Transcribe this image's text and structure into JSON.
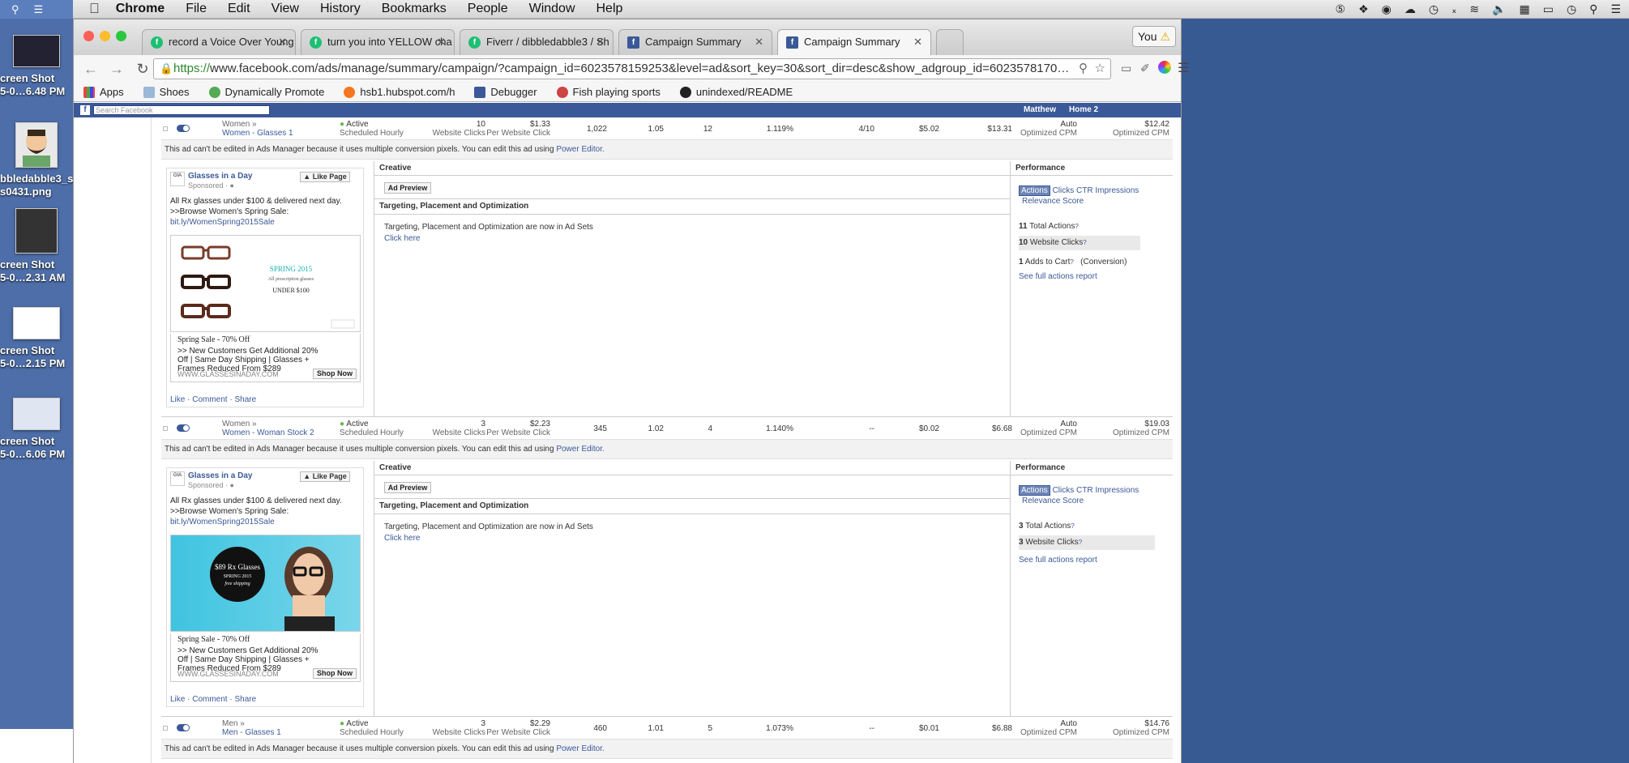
{
  "menubar": {
    "app": "Chrome",
    "items": [
      "File",
      "Edit",
      "View",
      "History",
      "Bookmarks",
      "People",
      "Window",
      "Help"
    ]
  },
  "desktop": {
    "icons": [
      {
        "label1": "creen Shot",
        "label2": "5-0…6.48 PM"
      },
      {
        "label1": "bbledabble3_s",
        "label2": "s0431.png"
      },
      {
        "label1": "creen Shot",
        "label2": "5-0…2.31 AM"
      },
      {
        "label1": "creen Shot",
        "label2": "5-0…2.15 PM"
      },
      {
        "label1": "creen Shot",
        "label2": "5-0…6.06 PM"
      }
    ]
  },
  "browser": {
    "tabs": [
      {
        "title": "record a Voice Over Young",
        "icon": "fiverr-icon",
        "color": "#1dbf73"
      },
      {
        "title": "turn you into YELLOW cha",
        "icon": "fiverr-icon",
        "color": "#1dbf73"
      },
      {
        "title": "Fiverr / dibbledabble3 / Sh",
        "icon": "fiverr-icon",
        "color": "#1dbf73"
      },
      {
        "title": "Campaign Summary",
        "icon": "facebook-icon",
        "color": "#3b5998"
      },
      {
        "title": "Campaign Summary",
        "icon": "facebook-icon",
        "color": "#3b5998"
      }
    ],
    "user_button": "You",
    "url_proto": "https://",
    "url_rest": "www.facebook.com/ads/manage/summary/campaign/?campaign_id=6023578159253&level=ad&sort_key=30&sort_dir=desc&show_adgroup_id=6023578170…",
    "bookmarks": [
      "Apps",
      "Shoes",
      "Dynamically Promote",
      "hsb1.hubspot.com/h",
      "Debugger",
      "Fish playing sports",
      "unindexed/README"
    ]
  },
  "fb": {
    "search_placeholder": "Search Facebook",
    "user": "Matthew",
    "home": "Home 2"
  },
  "ads": [
    {
      "group": "Women »",
      "name": "Women - Glasses 1",
      "status": "Active",
      "schedule": "Scheduled Hourly",
      "results": "10",
      "results_label": "Website Clicks",
      "cost": "$1.33",
      "cost_label": "Per Website Click",
      "reach": "1,022",
      "frequency": "1.05",
      "clicks": "12",
      "ctr": "1.119%",
      "relevance": "4/10",
      "cpc": "$5.02",
      "cpm": "$13.31",
      "bid": "Auto",
      "bid_label": "Optimized CPM",
      "spent": "$12.42",
      "spent_label": "Optimized CPM"
    },
    {
      "group": "Women »",
      "name": "Women - Woman Stock 2",
      "status": "Active",
      "schedule": "Scheduled Hourly",
      "results": "3",
      "results_label": "Website Clicks",
      "cost": "$2.23",
      "cost_label": "Per Website Click",
      "reach": "345",
      "frequency": "1.02",
      "clicks": "4",
      "ctr": "1.140%",
      "relevance": "--",
      "cpc": "$0.02",
      "cpm": "$6.68",
      "bid": "Auto",
      "bid_label": "Optimized CPM",
      "spent": "$19.03",
      "spent_label": "Optimized CPM"
    },
    {
      "group": "Men »",
      "name": "Men - Glasses 1",
      "status": "Active",
      "schedule": "Scheduled Hourly",
      "results": "3",
      "results_label": "Website Clicks",
      "cost": "$2.29",
      "cost_label": "Per Website Click",
      "reach": "460",
      "frequency": "1.01",
      "clicks": "5",
      "ctr": "1.073%",
      "relevance": "--",
      "cpc": "$0.01",
      "cpm": "$6.88",
      "bid": "Auto",
      "bid_label": "Optimized CPM",
      "spent": "$14.76",
      "spent_label": "Optimized CPM"
    }
  ],
  "note": {
    "text": "This ad can't be edited in Ads Manager because it uses multiple conversion pixels. You can edit this ad using ",
    "link": "Power Editor."
  },
  "adcard": {
    "page": "Glasses in a Day",
    "sponsored": "Sponsored · ",
    "like_page": "Like Page",
    "body1": "All Rx glasses under $100 & delivered next day.",
    "body2": ">>Browse Women's Spring Sale:",
    "link": "bit.ly/WomenSpring2015Sale",
    "caption": "Spring Sale - 70% Off",
    "desc": ">> New Customers Get Additional 20% Off | Same Day Shipping | Glasses + Frames Reduced From $289",
    "url": "WWW.GLASSESINADAY.COM",
    "shop_now": "Shop Now",
    "actions": "Like · Comment · Share",
    "img1_t1": "SPRING 2015",
    "img1_t2": "All prescription glasses",
    "img1_t3": "UNDER $100",
    "img2_t1": "$89 Rx Glasses",
    "img2_t2": "SPRING 2015",
    "img2_t3": "free shipping"
  },
  "panel": {
    "creative": "Creative",
    "ad_preview": "Ad Preview",
    "tpo_title": "Targeting, Placement and Optimization",
    "tpo_text": "Targeting, Placement and Optimization are now in Ad Sets",
    "click_here": "Click here",
    "performance": "Performance",
    "tabs": [
      "Actions",
      "Clicks",
      "CTR",
      "Impressions",
      "Relevance Score"
    ],
    "see_full": "See full actions report"
  },
  "perf1": {
    "total_num": "11",
    "total_label": " Total Actions",
    "clicks_num": "10",
    "clicks_label": " Website Clicks",
    "cart_num": "1",
    "cart_label": " Adds to Cart",
    "cart_conv": "(Conversion)"
  },
  "perf2": {
    "total_num": "3",
    "total_label": " Total Actions",
    "clicks_num": "3",
    "clicks_label": " Website Clicks"
  },
  "colors": {
    "facebook_blue": "#3b5998",
    "desktop_blue": "#4d6ea8",
    "active_green": "#6bb44e"
  }
}
